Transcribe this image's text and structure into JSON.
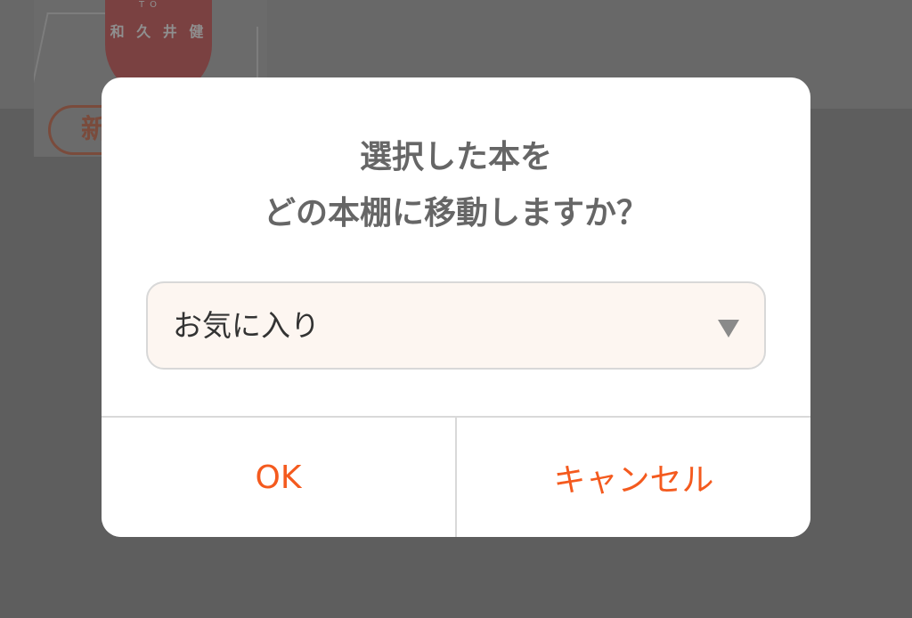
{
  "background": {
    "book_caption": "和 久 井 健",
    "book_small_text": "TO",
    "pill_label": "新"
  },
  "dialog": {
    "title_line1": "選択した本を",
    "title_line2": "どの本棚に移動しますか？",
    "shelf_select": {
      "selected": "お気に入り",
      "icon": "triangle-down-icon"
    },
    "ok_label": "OK",
    "cancel_label": "キャンセル"
  },
  "colors": {
    "accent": "#f45a1e",
    "overlay": "#5e5e5e",
    "title_text": "#666666",
    "select_bg": "#fdf6f1"
  }
}
